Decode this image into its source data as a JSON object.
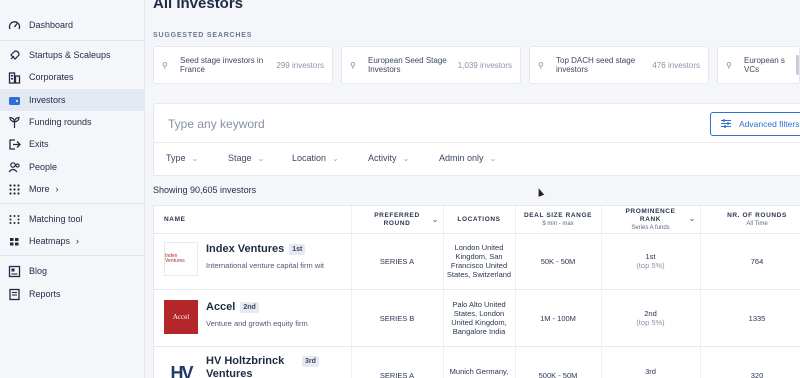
{
  "sidebar": {
    "items": [
      {
        "label": "Dashboard",
        "icon": "dashboard-icon"
      },
      {
        "label": "Startups & Scaleups",
        "icon": "rocket-icon"
      },
      {
        "label": "Corporates",
        "icon": "building-icon"
      },
      {
        "label": "Investors",
        "icon": "wallet-icon"
      },
      {
        "label": "Funding rounds",
        "icon": "seed-icon"
      },
      {
        "label": "Exits",
        "icon": "exit-icon"
      },
      {
        "label": "People",
        "icon": "people-icon"
      },
      {
        "label": "More",
        "icon": "grid-icon"
      },
      {
        "label": "Matching tool",
        "icon": "matching-icon"
      },
      {
        "label": "Heatmaps",
        "icon": "heatmap-icon"
      },
      {
        "label": "Blog",
        "icon": "blog-icon"
      },
      {
        "label": "Reports",
        "icon": "reports-icon"
      }
    ]
  },
  "page": {
    "title": "All Investors",
    "suggested_label": "SUGGESTED SEARCHES",
    "suggested": [
      {
        "text": "Seed stage investors in France",
        "count": "299 investors"
      },
      {
        "text": "European Seed Stage Investors",
        "count": "1,039 investors"
      },
      {
        "text": "Top DACH seed stage investors",
        "count": "476 investors"
      },
      {
        "text": "European s VCs",
        "count": ""
      }
    ],
    "search": {
      "placeholder": "Type any keyword"
    },
    "advanced_filters": "Advanced filters",
    "filters": [
      "Type",
      "Stage",
      "Location",
      "Activity",
      "Admin only"
    ],
    "showing": "Showing 90,605 investors"
  },
  "table": {
    "headers": {
      "name": "NAME",
      "round": "PREFERRED ROUND",
      "locations": "LOCATIONS",
      "deal": "DEAL SIZE RANGE",
      "deal_sub": "$ min - max",
      "prominence": "PROMINENCE RANK",
      "prominence_sub": "Series A funds",
      "rounds": "NR. OF ROUNDS",
      "rounds_sub": "All Time"
    },
    "rows": [
      {
        "name": "Index Ventures",
        "rank": "1st",
        "logo": "Index Ventures",
        "description": "International venture capital firm wit",
        "round": "SERIES A",
        "locations": "London United Kingdom, San Francisco United States, Switzerland",
        "deal": "50K - 50M",
        "prominence": "1st",
        "prominence_sub": "(top 5%)",
        "rounds": "764"
      },
      {
        "name": "Accel",
        "rank": "2nd",
        "logo": "Accel",
        "description": "Venture and growth equity firm",
        "round": "SERIES B",
        "locations": "Palo Alto United States, London United Kingdom, Bangalore India",
        "deal": "1M - 100M",
        "prominence": "2nd",
        "prominence_sub": "(top 5%)",
        "rounds": "1335"
      },
      {
        "name": "HV Holtzbrinck Ventures",
        "rank": "3rd",
        "logo": "HV",
        "description": "",
        "round": "SERIES A",
        "locations": "Munich Germany,",
        "deal": "500K - 50M",
        "prominence": "3rd",
        "prominence_sub": "",
        "rounds": "320"
      }
    ]
  },
  "colors": {
    "accent": "#2f6fd6",
    "active_bg": "#e3e9f3",
    "accel_red": "#b3272b"
  }
}
